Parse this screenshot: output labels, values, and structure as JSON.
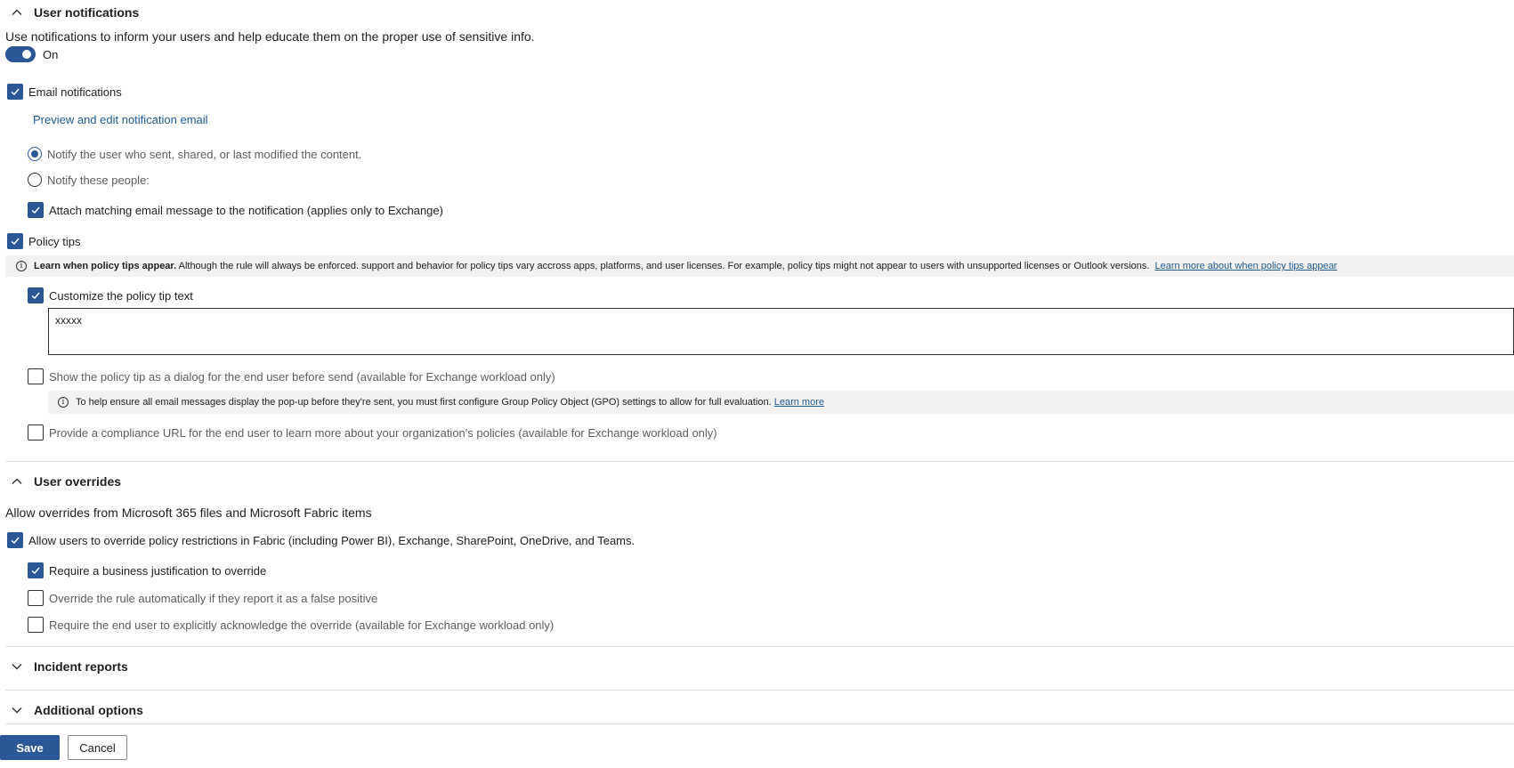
{
  "user_notifications": {
    "title": "User notifications",
    "description": "Use notifications to inform your users and help educate them on the proper use of sensitive info.",
    "toggle_label": "On",
    "email_notifications": {
      "label": "Email notifications",
      "checked": true,
      "preview_link": "Preview and edit notification email",
      "radio_options": [
        {
          "label": "Notify the user who sent, shared, or last modified the content.",
          "selected": true
        },
        {
          "label": "Notify these people:",
          "selected": false
        }
      ],
      "attach_label": "Attach matching email message to the notification (applies only to Exchange)"
    },
    "policy_tips": {
      "label": "Policy tips",
      "info_bold": "Learn when policy tips appear.",
      "info_text": " Although the rule will always be enforced. support and behavior for policy tips vary accross apps, platforms, and user licenses. For example, policy tips might not appear to users with unsupported licenses or Outlook versions.",
      "info_link": "Learn more about when policy tips appear",
      "customize_label": "Customize the policy tip text",
      "tip_text_value": "xxxxx",
      "dialog_label": "Show the policy tip as a dialog for the end user before send (available for Exchange workload only)",
      "gpo_info_text": "To help ensure all email messages display the pop-up before they're sent, you must first configure Group Policy Object (GPO) settings to allow for full evaluation.",
      "gpo_info_link": "Learn more",
      "compliance_url_label": "Provide a compliance URL for the end user to learn more about your organization's policies (available for Exchange workload only)"
    }
  },
  "user_overrides": {
    "title": "User overrides",
    "description": "Allow overrides from Microsoft 365 files and Microsoft Fabric items",
    "allow_label": "Allow users to override policy restrictions in Fabric (including Power BI), Exchange, SharePoint, OneDrive, and Teams.",
    "justification_label": "Require a business justification to override",
    "false_positive_label": "Override the rule automatically if they report it as a false positive",
    "acknowledge_label": "Require the end user to explicitly acknowledge the override (available for Exchange workload only)"
  },
  "incident_reports": {
    "title": "Incident reports"
  },
  "additional_options": {
    "title": "Additional options"
  },
  "footer": {
    "save_label": "Save",
    "cancel_label": "Cancel"
  },
  "colors": {
    "accent": "#2b5797",
    "link": "#1f5b96",
    "info_bg": "#f3f2f1"
  },
  "icons": {
    "expanded": "chevron-up-icon",
    "collapsed": "chevron-down-icon",
    "info": "info-icon",
    "check": "checkmark-icon"
  }
}
